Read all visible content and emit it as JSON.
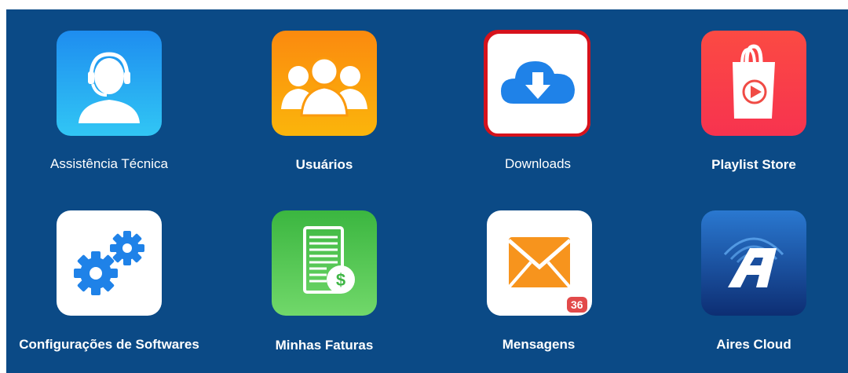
{
  "apps": [
    {
      "id": "assistencia",
      "label": "Assistência Técnica",
      "icon": "headset-user-icon"
    },
    {
      "id": "usuarios",
      "label": "Usuários",
      "icon": "users-group-icon"
    },
    {
      "id": "downloads",
      "label": "Downloads",
      "icon": "cloud-download-icon"
    },
    {
      "id": "playlist",
      "label": "Playlist Store",
      "icon": "shopping-bag-play-icon"
    },
    {
      "id": "config",
      "label": "Configurações de Softwares",
      "icon": "gears-icon"
    },
    {
      "id": "faturas",
      "label": "Minhas Faturas",
      "icon": "invoice-dollar-icon"
    },
    {
      "id": "mensagens",
      "label": "Mensagens",
      "icon": "envelope-icon",
      "badge": "36"
    },
    {
      "id": "aires",
      "label": "Aires Cloud",
      "icon": "aires-logo-icon"
    }
  ],
  "colors": {
    "background": "#0b4a86",
    "selected_outline": "#d6121c",
    "badge": "#e24a4a"
  }
}
